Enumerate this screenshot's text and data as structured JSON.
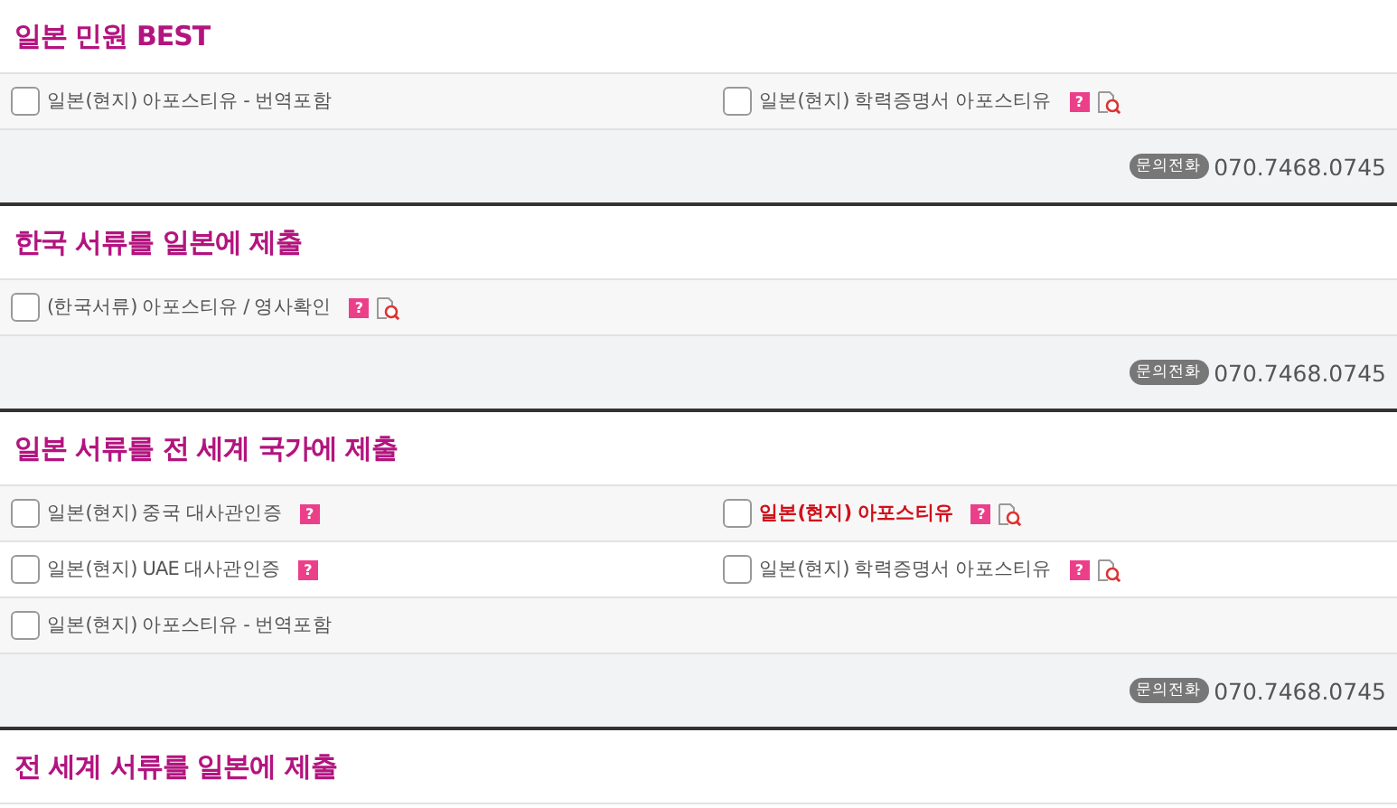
{
  "sections": [
    {
      "title": "일본 민원 BEST",
      "rows": [
        [
          {
            "label": "일본(현지) 아포스티유 - 번역포함",
            "checked": false,
            "highlighted": false,
            "preview": false
          },
          {
            "label": "일본(현지) 학력증명서 아포스티유",
            "checked": false,
            "highlighted": false,
            "help": "?",
            "preview": true
          }
        ]
      ],
      "contact": {
        "badge": "문의전화",
        "phone": "070.7468.0745"
      }
    },
    {
      "title": "한국 서류를 일본에 제출",
      "rows": [
        [
          {
            "label": "(한국서류) 아포스티유 / 영사확인",
            "checked": false,
            "highlighted": false,
            "help": "?",
            "preview": true
          }
        ]
      ],
      "contact": {
        "badge": "문의전화",
        "phone": "070.7468.0745"
      }
    },
    {
      "title": "일본 서류를 전 세계 국가에 제출",
      "rows": [
        [
          {
            "label": "일본(현지) 중국 대사관인증",
            "checked": false,
            "highlighted": false,
            "help": "?",
            "preview": false
          },
          {
            "label": "일본(현지) 아포스티유",
            "checked": false,
            "highlighted": true,
            "help": "?",
            "preview": true
          }
        ],
        [
          {
            "label": "일본(현지) UAE 대사관인증",
            "checked": false,
            "highlighted": false,
            "help": "?",
            "preview": false
          },
          {
            "label": "일본(현지) 학력증명서 아포스티유",
            "checked": false,
            "highlighted": false,
            "help": "?",
            "preview": true
          }
        ],
        [
          {
            "label": "일본(현지) 아포스티유 - 번역포함",
            "checked": false,
            "highlighted": false,
            "preview": false
          }
        ]
      ],
      "contact": {
        "badge": "문의전화",
        "phone": "070.7468.0745"
      }
    },
    {
      "title": "전 세계 서류를 일본에 제출"
    }
  ]
}
